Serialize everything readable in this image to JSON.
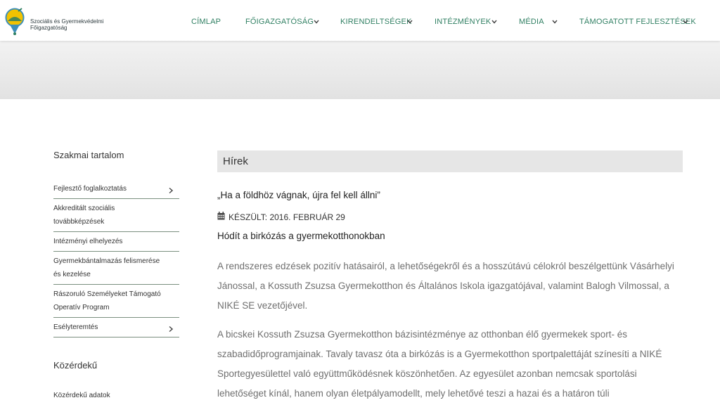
{
  "header": {
    "logo_text_line1": "Szociális és Gyermekvédelmi",
    "logo_text_line2": "Főigazgatóság",
    "nav": [
      {
        "label": "CÍMLAP",
        "has_dropdown": false
      },
      {
        "label": "FŐIGAZGATÓSÁG",
        "has_dropdown": true
      },
      {
        "label": "KIRENDELTSÉGEK",
        "has_dropdown": true
      },
      {
        "label": "INTÉZMÉNYEK",
        "has_dropdown": true
      },
      {
        "label": "MÉDIA",
        "has_dropdown": true
      },
      {
        "label": "TÁMOGATOTT FEJLESZTÉSEK",
        "has_dropdown": true
      }
    ]
  },
  "sidebar": {
    "section1_title": "Szakmai tartalom",
    "items": [
      {
        "label": "Fejlesztő foglalkoztatás",
        "has_submenu": true
      },
      {
        "label": "Akkreditált szociális továbbképzések",
        "has_submenu": false
      },
      {
        "label": "Intézményi elhelyezés",
        "has_submenu": false
      },
      {
        "label": "Gyermekbántalmazás felismerése és kezelése",
        "has_submenu": false
      },
      {
        "label": "Rászoruló Személyeket Támogató Operatív Program",
        "has_submenu": false
      },
      {
        "label": "Esélyteremtés",
        "has_submenu": true
      }
    ],
    "section2_title": "Közérdekű",
    "section2_item": "Közérdekű adatok"
  },
  "main": {
    "heading": "Hírek",
    "article_title": "„Ha a földhöz vágnak, újra fel kell állni”",
    "meta_label": "KÉSZÜLT: 2016. FEBRUÁR 29",
    "subtitle": "Hódít a birkózás a gyermekotthonokban",
    "paragraph1": "A rendszeres edzések pozitív hatásairól, a lehetőségekről és a hosszútávú célokról beszélgettünk Vásárhelyi Jánossal, a Kossuth Zsuzsa Gyermekotthon és Általános Iskola  igazgatójával, valamint Balogh Vilmossal, a NIKÉ SE vezetőjével.",
    "paragraph2": "A bicskei Kossuth Zsuzsa Gyermekotthon bázisintézménye az otthonban élő gyermekek sport- és szabadidőprogramjainak. Tavaly tavasz óta a birkózás is a Gyermekotthon sportpalettáját színesíti a NIKÉ Sportegyesülettel való együttműködésnek köszönhetően. Az egyesület azonban nemcsak sportolási lehetőséget kínál, hanem olyan életpályamodellt, mely lehetővé teszi a hazai és a határon túli"
  },
  "colors": {
    "nav_green": "#2f7f62",
    "logo_yellow": "#f2c200",
    "logo_blue": "#3d8fb8",
    "heading_bg": "#e6e6e6"
  },
  "icons": {
    "logo": "pin-logo-icon",
    "dropdown": "chevron-down-icon",
    "submenu": "chevron-right-icon",
    "date": "calendar-icon"
  }
}
